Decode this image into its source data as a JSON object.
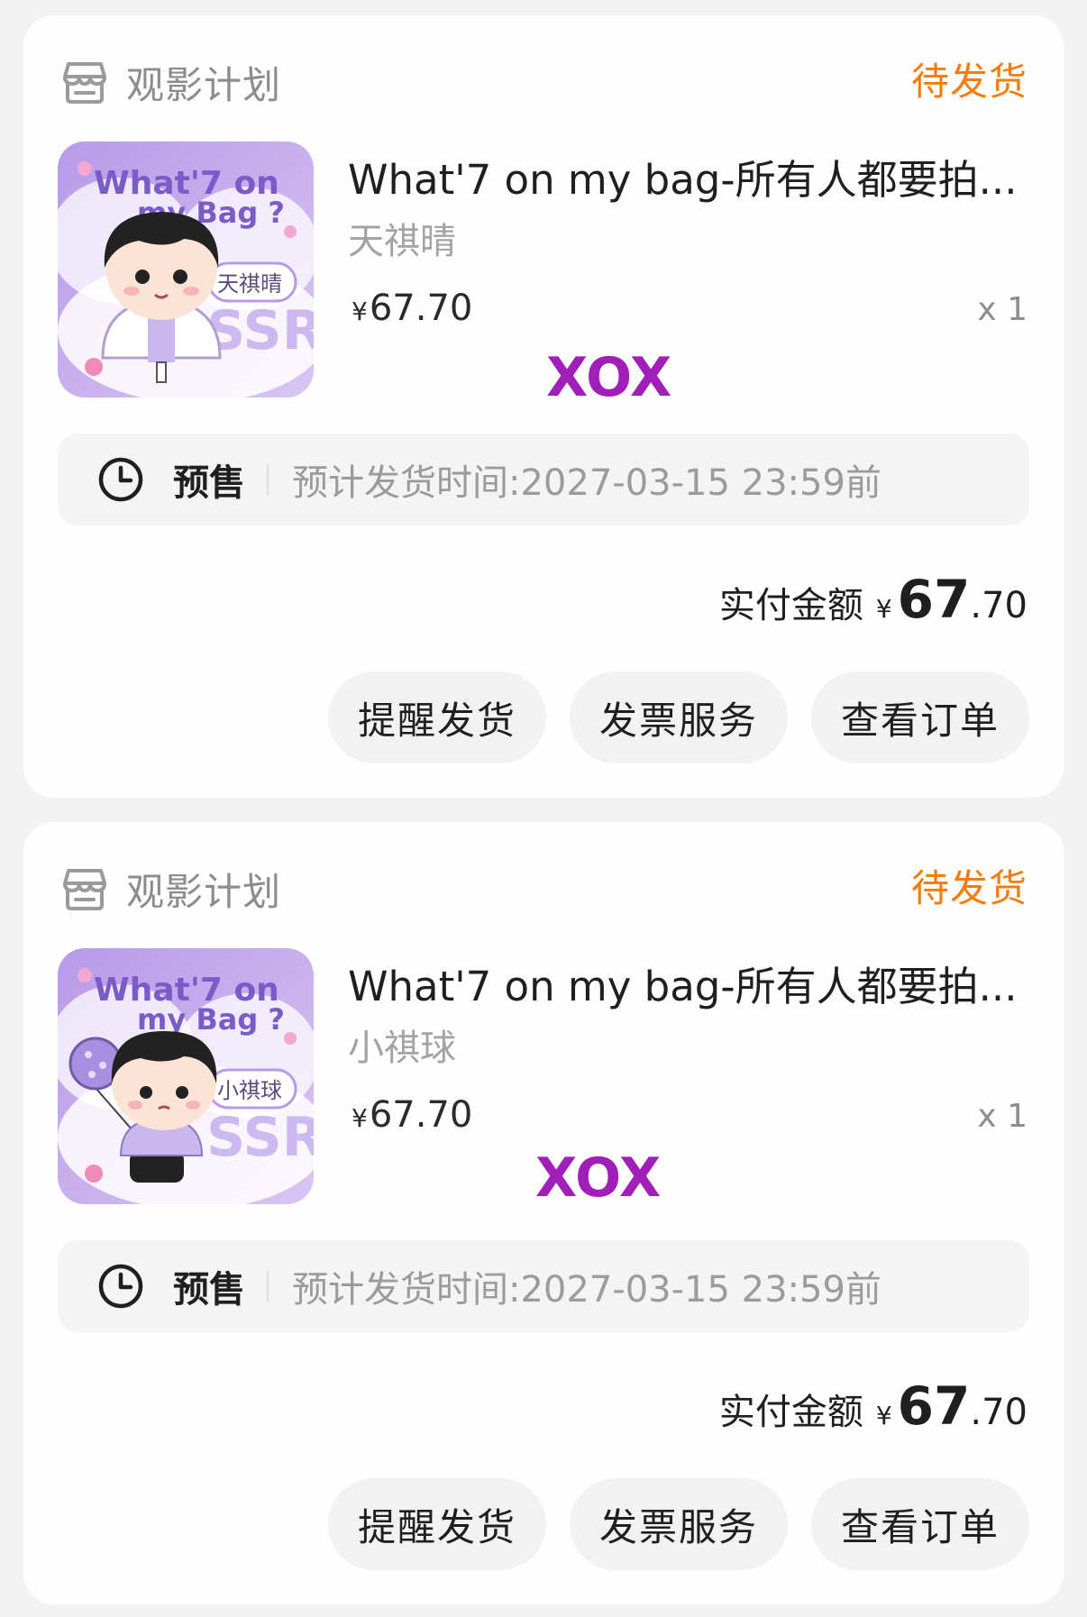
{
  "colors": {
    "status": "#f47c0a",
    "watermark": "#a01fb8",
    "card_bg": "#fefefe",
    "page_bg": "#f2f2f2"
  },
  "orders": [
    {
      "shop_name": "观影计划",
      "status": "待发货",
      "product_title": "What'7 on my bag-所有人都要拍...",
      "variant": "天祺晴",
      "image_text": {
        "line1": "What'7 on",
        "line2": "my Bag ?",
        "tag": "天祺晴",
        "bg_text": "SSR"
      },
      "price_symbol": "¥",
      "price_value": "67.70",
      "quantity": "x 1",
      "watermark": "XOX",
      "presale_label": "预售",
      "ship_time": "预计发货时间:2027-03-15 23:59前",
      "total_label": "实付金额",
      "total_symbol": "¥",
      "total_int": "67",
      "total_dec": ".70",
      "buttons": [
        "提醒发货",
        "发票服务",
        "查看订单"
      ]
    },
    {
      "shop_name": "观影计划",
      "status": "待发货",
      "product_title": "What'7 on my bag-所有人都要拍...",
      "variant": "小祺球",
      "image_text": {
        "line1": "What'7 on",
        "line2": "my Bag ?",
        "tag": "小祺球",
        "bg_text": "SSR"
      },
      "price_symbol": "¥",
      "price_value": "67.70",
      "quantity": "x 1",
      "watermark": "XOX",
      "presale_label": "预售",
      "ship_time": "预计发货时间:2027-03-15 23:59前",
      "total_label": "实付金额",
      "total_symbol": "¥",
      "total_int": "67",
      "total_dec": ".70",
      "buttons": [
        "提醒发货",
        "发票服务",
        "查看订单"
      ]
    }
  ]
}
